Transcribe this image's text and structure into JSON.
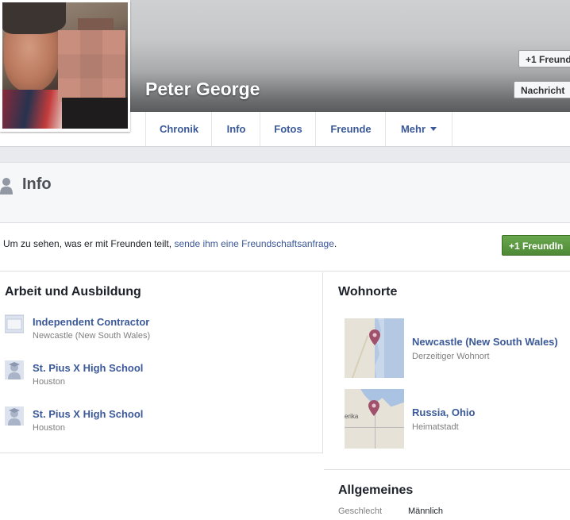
{
  "profile": {
    "name": "Peter George",
    "add_friend_button": "+1 Freund",
    "message_button": "Nachricht"
  },
  "nav": {
    "tabs": [
      "Chronik",
      "Info",
      "Fotos",
      "Freunde",
      "Mehr"
    ]
  },
  "info": {
    "title": "Info"
  },
  "friend_request": {
    "text_before": "Um zu sehen, was er mit Freunden teilt,",
    "link": "sende ihm eine Freundschaftsanfrage",
    "text_after": ".",
    "button": "+1 FreundIn"
  },
  "work": {
    "title": "Arbeit und Ausbildung",
    "items": [
      {
        "title": "Independent Contractor",
        "sub": "Newcastle (New South Wales)",
        "icon": "briefcase-icon"
      },
      {
        "title": "St. Pius X High School",
        "sub": "Houston",
        "icon": "graduation-icon"
      },
      {
        "title": "St. Pius X High School",
        "sub": "Houston",
        "icon": "graduation-icon"
      }
    ]
  },
  "places": {
    "title": "Wohnorte",
    "items": [
      {
        "title": "Newcastle (New South Wales)",
        "sub": "Derzeitiger Wohnort"
      },
      {
        "title": "Russia, Ohio",
        "sub": "Heimatstadt",
        "map_label": "erika"
      }
    ]
  },
  "general": {
    "title": "Allgemeines",
    "gender_label": "Geschlecht",
    "gender_value": "Männlich"
  },
  "colors": {
    "link": "#3b5998",
    "green_button": "#4e8a36"
  }
}
